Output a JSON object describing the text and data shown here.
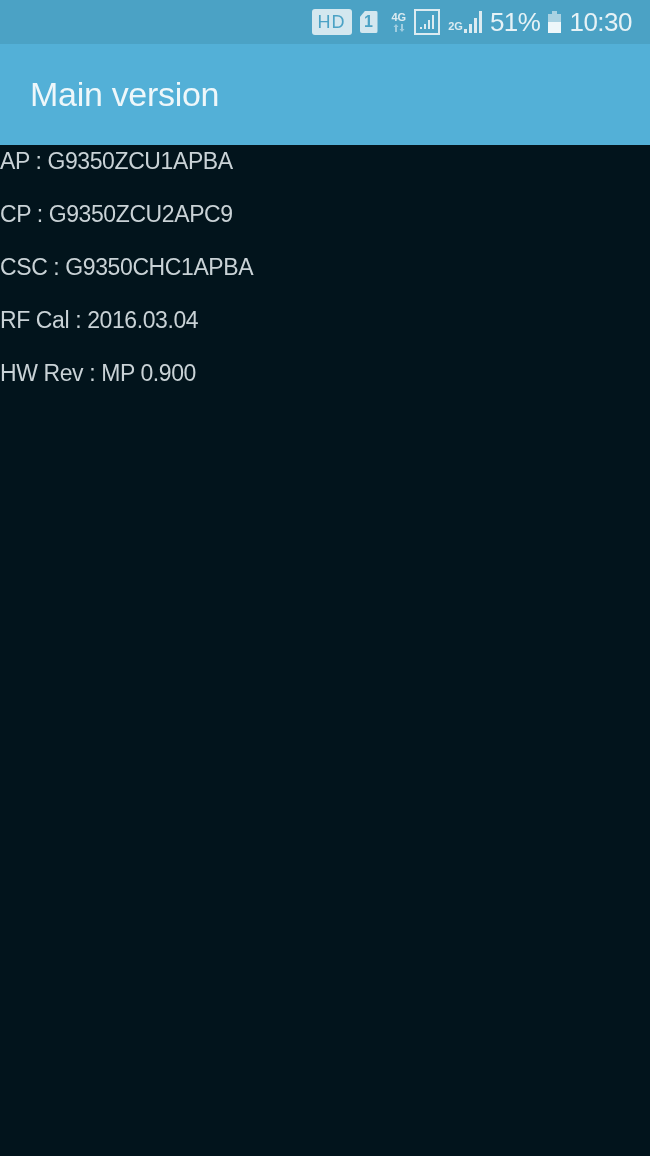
{
  "status_bar": {
    "hd_badge": "HD",
    "sim_slot": "1",
    "network_type": "4G",
    "second_network_type": "2G",
    "battery": "51%",
    "time": "10:30"
  },
  "app_bar": {
    "title": "Main version"
  },
  "info_lines": [
    "AP : G9350ZCU1APBA",
    "CP : G9350ZCU2APC9",
    "CSC : G9350CHC1APBA",
    "RF Cal : 2016.03.04",
    "HW Rev : MP 0.900"
  ]
}
